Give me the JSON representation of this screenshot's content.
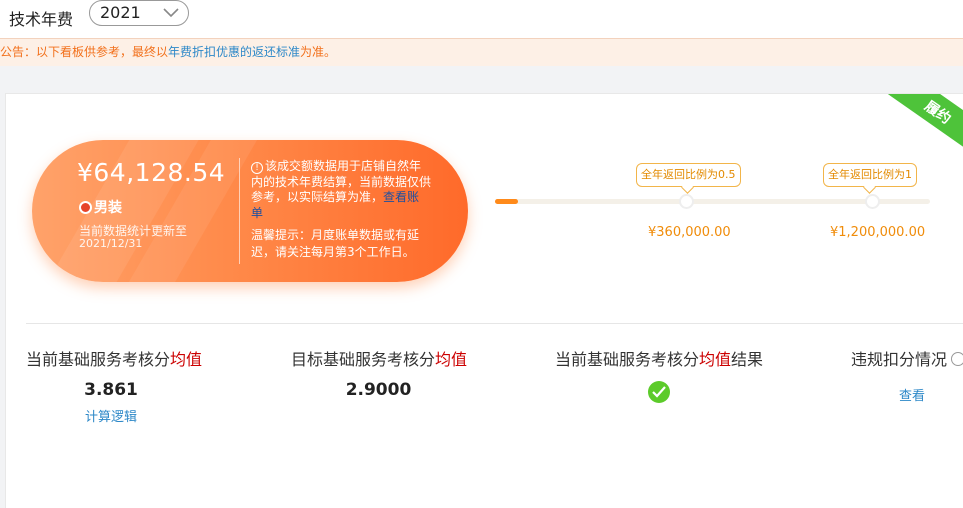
{
  "header": {
    "label": "技术年费",
    "year_select": {
      "value": "2021",
      "icon": "chevron-down-icon"
    }
  },
  "notice": {
    "text_before": "公告：以下看板供参考，最终以",
    "link_text": "年费折扣优惠的返还标准",
    "text_after": "为准。"
  },
  "ribbon": {
    "text": "履约"
  },
  "summary": {
    "amount": "¥64,128.54",
    "category": "男装",
    "updated_label": "当前数据统计更新至",
    "updated_date": "2021/12/31",
    "info_text": "该成交额数据用于店铺自然年内的技术年费结算，当前数据仅供参考，以实际结算为准，",
    "info_link": "查看账单",
    "tip_text": "温馨提示：月度账单数据或有延迟，请关注每月第3个工作日。"
  },
  "progress": {
    "current_fraction": 0.053,
    "tiers": [
      {
        "label": "全年返回比例为0.5",
        "amount": "¥360,000.00"
      },
      {
        "label": "全年返回比例为1",
        "amount": "¥1,200,000.00"
      }
    ],
    "colors": {
      "fill": "#ff8a1a",
      "track": "#f4f0e8",
      "amount": "#f08c0a"
    }
  },
  "metrics": {
    "current": {
      "title_prefix": "当前基础服务考核分",
      "title_highlight": "均值",
      "value": "3.861",
      "link": "计算逻辑"
    },
    "target": {
      "title_prefix": "目标基础服务考核分",
      "title_highlight": "均值",
      "value": "2.9000"
    },
    "result": {
      "title_prefix": "当前基础服务考核分",
      "title_highlight": "均值",
      "title_suffix": "结果",
      "icon": "check-circle-icon"
    },
    "violation": {
      "title": "违规扣分情况",
      "link": "查看",
      "icon": "question-icon"
    }
  }
}
